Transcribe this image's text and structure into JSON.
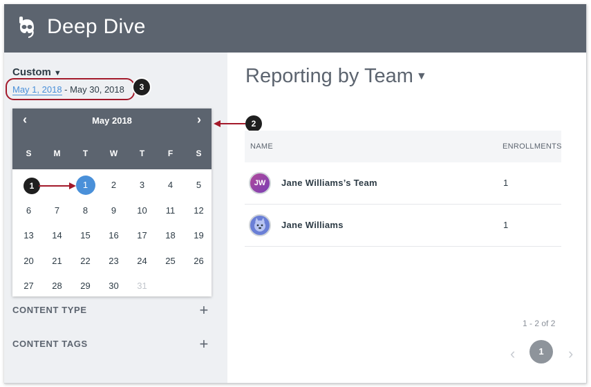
{
  "app": {
    "title": "Deep Dive"
  },
  "sidebar": {
    "range_label": "Custom",
    "range_start": "May 1, 2018",
    "range_end": " - May 30, 2018",
    "filters": [
      {
        "label": "CONTENT TYPE"
      },
      {
        "label": "CONTENT TAGS"
      }
    ]
  },
  "calendar": {
    "month": "May 2018",
    "days_of_week": [
      "S",
      "M",
      "T",
      "W",
      "T",
      "F",
      "S"
    ],
    "weeks": [
      [
        "",
        "",
        "1",
        "2",
        "3",
        "4",
        "5"
      ],
      [
        "6",
        "7",
        "8",
        "9",
        "10",
        "11",
        "12"
      ],
      [
        "13",
        "14",
        "15",
        "16",
        "17",
        "18",
        "19"
      ],
      [
        "20",
        "21",
        "22",
        "23",
        "24",
        "25",
        "26"
      ],
      [
        "27",
        "28",
        "29",
        "30",
        "31",
        "",
        ""
      ]
    ],
    "selected_day": "1",
    "disabled_days": [
      "31"
    ]
  },
  "callouts": [
    "1",
    "2",
    "3"
  ],
  "main": {
    "title": "Reporting by Team",
    "table": {
      "headers": [
        "NAME",
        "ENROLLMENTS"
      ],
      "rows": [
        {
          "initials": "JW",
          "name": "Jane Williams’s Team",
          "enrollments": "1"
        },
        {
          "initials": "",
          "name": "Jane Williams",
          "enrollments": "1"
        }
      ]
    }
  },
  "pagination": {
    "info": "1 - 2 of 2",
    "current_page": "1"
  },
  "colors": {
    "header": "#5c646f",
    "accent": "#4a90d9",
    "callout": "#a3192a",
    "sidebar": "#eef0f3"
  }
}
